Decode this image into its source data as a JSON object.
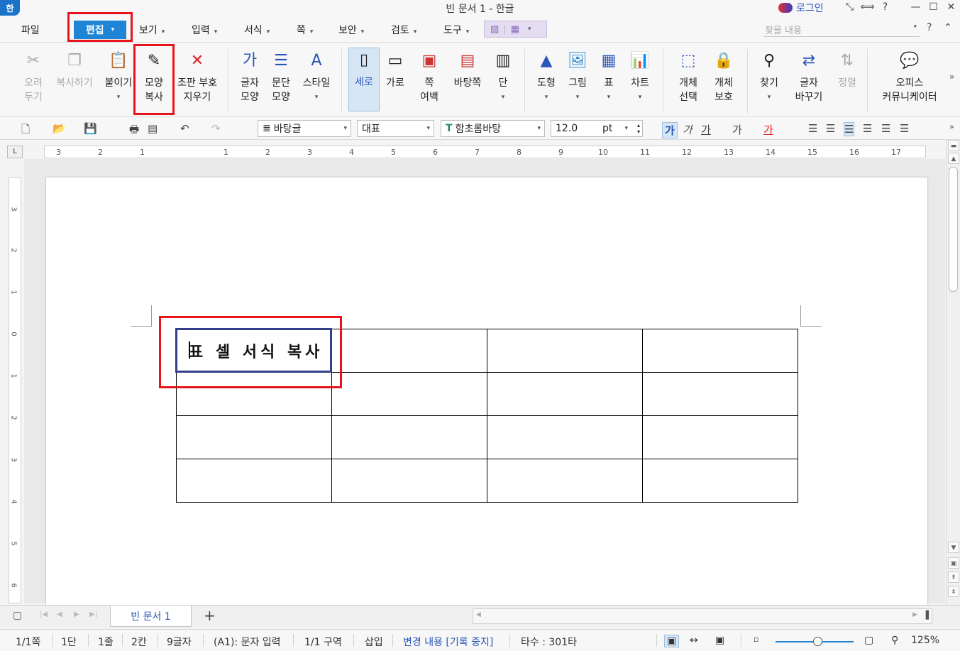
{
  "titlebar": {
    "app_icon": "한",
    "title": "빈 문서 1 - 한글",
    "login": "로그인",
    "controls": [
      "⤡",
      "⟺",
      "?",
      "—",
      "☐",
      "✕"
    ]
  },
  "menu": {
    "file": "파일",
    "edit": "편집",
    "items": [
      "보기",
      "입력",
      "서식",
      "쪽",
      "보안",
      "검토",
      "도구"
    ],
    "search_placeholder": "찾을 내용",
    "right": [
      "?",
      "⌃",
      "✕"
    ]
  },
  "ribbon": {
    "cut": [
      "오려",
      "두기"
    ],
    "copy": "복사하기",
    "paste": "붙이기",
    "format_copy": [
      "모양",
      "복사"
    ],
    "clear_marks": [
      "조판 부호",
      "지우기"
    ],
    "char_shape": [
      "글자",
      "모양"
    ],
    "para_shape": [
      "문단",
      "모양"
    ],
    "style": "스타일",
    "portrait": "세로",
    "landscape": "가로",
    "margin": [
      "쪽",
      "여백"
    ],
    "page_bg": "바탕쪽",
    "columns": "단",
    "shape": "도형",
    "picture": "그림",
    "table": "표",
    "chart": "차트",
    "obj_select": [
      "개체",
      "선택"
    ],
    "obj_protect": [
      "개체",
      "보호"
    ],
    "find": "찾기",
    "replace": [
      "글자",
      "바꾸기"
    ],
    "sort": "정렬",
    "office": [
      "오피스",
      "커뮤니케이터"
    ]
  },
  "format": {
    "style": "바탕글",
    "lang": "대표",
    "font": "함초롬바탕",
    "size": "12.0",
    "unit": "pt"
  },
  "ruler_h": [
    "3",
    "2",
    "1",
    "1",
    "2",
    "3",
    "4",
    "5",
    "6",
    "7",
    "8",
    "9",
    "10",
    "11",
    "12",
    "13",
    "14",
    "15",
    "16",
    "17"
  ],
  "ruler_v": [
    "3",
    "2",
    "1",
    "0",
    "1",
    "2",
    "3",
    "4",
    "5",
    "6"
  ],
  "document": {
    "cell_a1": "표 셀 서식 복사"
  },
  "tabs": {
    "active": "빈 문서 1",
    "add": "+"
  },
  "status": {
    "page": "1/1쪽",
    "col": "1단",
    "line": "1줄",
    "char_col": "2칸",
    "chars": "9글자",
    "mode": "(A1): 문자 입력",
    "section": "1/1 구역",
    "insert": "삽입",
    "track": "변경 내용 [기록 중지]",
    "typing": "타수 : 301타",
    "zoom": "125%"
  },
  "colors": {
    "accent": "#1d84d6",
    "highlight_red": "#e8141c",
    "cell_selection": "#343f8c"
  }
}
